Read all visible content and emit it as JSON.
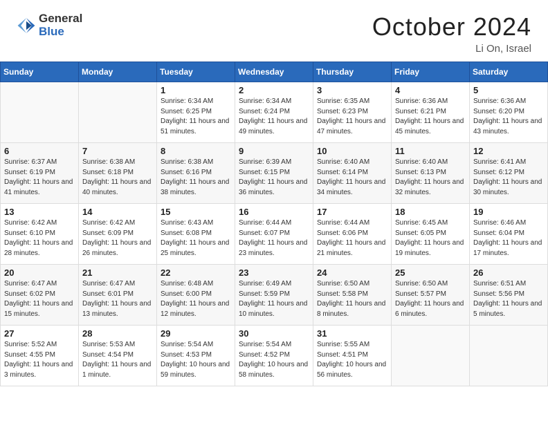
{
  "logo": {
    "general": "General",
    "blue": "Blue"
  },
  "title": {
    "month": "October 2024",
    "location": "Li On, Israel"
  },
  "weekdays": [
    "Sunday",
    "Monday",
    "Tuesday",
    "Wednesday",
    "Thursday",
    "Friday",
    "Saturday"
  ],
  "weeks": [
    [
      {
        "day": "",
        "info": ""
      },
      {
        "day": "",
        "info": ""
      },
      {
        "day": "1",
        "info": "Sunrise: 6:34 AM\nSunset: 6:25 PM\nDaylight: 11 hours and 51 minutes."
      },
      {
        "day": "2",
        "info": "Sunrise: 6:34 AM\nSunset: 6:24 PM\nDaylight: 11 hours and 49 minutes."
      },
      {
        "day": "3",
        "info": "Sunrise: 6:35 AM\nSunset: 6:23 PM\nDaylight: 11 hours and 47 minutes."
      },
      {
        "day": "4",
        "info": "Sunrise: 6:36 AM\nSunset: 6:21 PM\nDaylight: 11 hours and 45 minutes."
      },
      {
        "day": "5",
        "info": "Sunrise: 6:36 AM\nSunset: 6:20 PM\nDaylight: 11 hours and 43 minutes."
      }
    ],
    [
      {
        "day": "6",
        "info": "Sunrise: 6:37 AM\nSunset: 6:19 PM\nDaylight: 11 hours and 41 minutes."
      },
      {
        "day": "7",
        "info": "Sunrise: 6:38 AM\nSunset: 6:18 PM\nDaylight: 11 hours and 40 minutes."
      },
      {
        "day": "8",
        "info": "Sunrise: 6:38 AM\nSunset: 6:16 PM\nDaylight: 11 hours and 38 minutes."
      },
      {
        "day": "9",
        "info": "Sunrise: 6:39 AM\nSunset: 6:15 PM\nDaylight: 11 hours and 36 minutes."
      },
      {
        "day": "10",
        "info": "Sunrise: 6:40 AM\nSunset: 6:14 PM\nDaylight: 11 hours and 34 minutes."
      },
      {
        "day": "11",
        "info": "Sunrise: 6:40 AM\nSunset: 6:13 PM\nDaylight: 11 hours and 32 minutes."
      },
      {
        "day": "12",
        "info": "Sunrise: 6:41 AM\nSunset: 6:12 PM\nDaylight: 11 hours and 30 minutes."
      }
    ],
    [
      {
        "day": "13",
        "info": "Sunrise: 6:42 AM\nSunset: 6:10 PM\nDaylight: 11 hours and 28 minutes."
      },
      {
        "day": "14",
        "info": "Sunrise: 6:42 AM\nSunset: 6:09 PM\nDaylight: 11 hours and 26 minutes."
      },
      {
        "day": "15",
        "info": "Sunrise: 6:43 AM\nSunset: 6:08 PM\nDaylight: 11 hours and 25 minutes."
      },
      {
        "day": "16",
        "info": "Sunrise: 6:44 AM\nSunset: 6:07 PM\nDaylight: 11 hours and 23 minutes."
      },
      {
        "day": "17",
        "info": "Sunrise: 6:44 AM\nSunset: 6:06 PM\nDaylight: 11 hours and 21 minutes."
      },
      {
        "day": "18",
        "info": "Sunrise: 6:45 AM\nSunset: 6:05 PM\nDaylight: 11 hours and 19 minutes."
      },
      {
        "day": "19",
        "info": "Sunrise: 6:46 AM\nSunset: 6:04 PM\nDaylight: 11 hours and 17 minutes."
      }
    ],
    [
      {
        "day": "20",
        "info": "Sunrise: 6:47 AM\nSunset: 6:02 PM\nDaylight: 11 hours and 15 minutes."
      },
      {
        "day": "21",
        "info": "Sunrise: 6:47 AM\nSunset: 6:01 PM\nDaylight: 11 hours and 13 minutes."
      },
      {
        "day": "22",
        "info": "Sunrise: 6:48 AM\nSunset: 6:00 PM\nDaylight: 11 hours and 12 minutes."
      },
      {
        "day": "23",
        "info": "Sunrise: 6:49 AM\nSunset: 5:59 PM\nDaylight: 11 hours and 10 minutes."
      },
      {
        "day": "24",
        "info": "Sunrise: 6:50 AM\nSunset: 5:58 PM\nDaylight: 11 hours and 8 minutes."
      },
      {
        "day": "25",
        "info": "Sunrise: 6:50 AM\nSunset: 5:57 PM\nDaylight: 11 hours and 6 minutes."
      },
      {
        "day": "26",
        "info": "Sunrise: 6:51 AM\nSunset: 5:56 PM\nDaylight: 11 hours and 5 minutes."
      }
    ],
    [
      {
        "day": "27",
        "info": "Sunrise: 5:52 AM\nSunset: 4:55 PM\nDaylight: 11 hours and 3 minutes."
      },
      {
        "day": "28",
        "info": "Sunrise: 5:53 AM\nSunset: 4:54 PM\nDaylight: 11 hours and 1 minute."
      },
      {
        "day": "29",
        "info": "Sunrise: 5:54 AM\nSunset: 4:53 PM\nDaylight: 10 hours and 59 minutes."
      },
      {
        "day": "30",
        "info": "Sunrise: 5:54 AM\nSunset: 4:52 PM\nDaylight: 10 hours and 58 minutes."
      },
      {
        "day": "31",
        "info": "Sunrise: 5:55 AM\nSunset: 4:51 PM\nDaylight: 10 hours and 56 minutes."
      },
      {
        "day": "",
        "info": ""
      },
      {
        "day": "",
        "info": ""
      }
    ]
  ]
}
